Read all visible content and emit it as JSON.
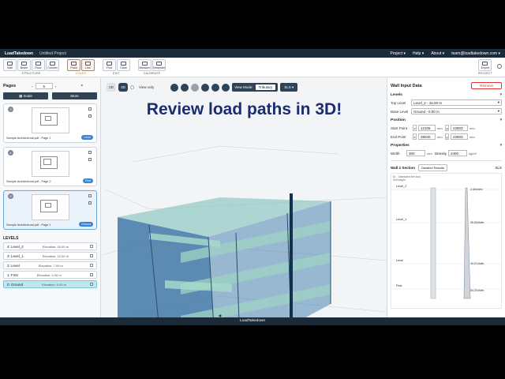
{
  "app": {
    "brand": "LoadTakedown",
    "project": "Untitled Project",
    "menus": [
      "Project",
      "Help",
      "About",
      "team@loadtakedown.com"
    ],
    "footer": "LoadTakedown"
  },
  "toolbar": {
    "groups": [
      {
        "label": "STRUCTURE",
        "buttons": [
          "Wall",
          "Beam",
          "Floor",
          "Column"
        ]
      },
      {
        "label": "LOADS",
        "buttons": [
          "Point",
          "Line"
        ]
      },
      {
        "label": "EDIT",
        "buttons": [
          "Find",
          "Clear"
        ]
      },
      {
        "label": "CALIBRATE",
        "buttons": [
          "Measure",
          "Viewpoint"
        ]
      }
    ],
    "export": {
      "button": "Export",
      "label": "PROJECT"
    }
  },
  "pages": {
    "title": "Pages",
    "current": "5",
    "scale_button": "Scale",
    "more_button": "More",
    "items": [
      {
        "num": "3",
        "title": "Sample Architectural.pdf - Page 1",
        "tag": "Level"
      },
      {
        "num": "4",
        "title": "Sample Architectural.pdf - Page 2",
        "tag": "First"
      },
      {
        "num": "5",
        "title": "Sample Architectural.pdf - Page 1",
        "tag": "Ground"
      }
    ]
  },
  "levels": {
    "title": "LEVELS",
    "items": [
      {
        "name": "4: Level_2",
        "elev": "Elevation: 16.00 m"
      },
      {
        "name": "3: Level_1",
        "elev": "Elevation: 12.00 m"
      },
      {
        "name": "2: Level",
        "elev": "Elevation: 7.00 m"
      },
      {
        "name": "1: First",
        "elev": "Elevation: 4.00 m"
      },
      {
        "name": "0: Ground",
        "elev": "Elevation: 0.00 m"
      }
    ]
  },
  "viewport": {
    "btn_2d": "2D",
    "btn_3d": "3D",
    "view_only": "View only",
    "view_mode_label": "View Mode:",
    "view_mode_value": "Tributary",
    "load_case": "SLS",
    "headline": "Review load paths in 3D!"
  },
  "panel": {
    "title": "Wall Input Data",
    "remove": "Remove",
    "levels_section": "Levels",
    "top_level_label": "Top Level",
    "top_level_value": "Level_2 - 16.00 m",
    "base_level_label": "Base Level",
    "base_level_value": "Ground - 0.00 m",
    "position_section": "Position",
    "start_label": "Start Point",
    "start_x": "12105",
    "start_y": "22803",
    "end_label": "End Point",
    "end_x": "39040",
    "end_y": "22803",
    "unit_mm": "mm",
    "properties_section": "Properties",
    "width_label": "Width",
    "width_value": "300",
    "density_label": "Density",
    "density_value": "2400",
    "density_unit": "kg/m³",
    "wall_section": "Wall 2 Section",
    "detailed_results": "Detailed Results",
    "section_case": "SLS",
    "legend_1": "DL",
    "legend_2": "Distributed line load",
    "legend_3": "Self weight",
    "chart_levels": [
      "Level_2",
      "Level_1",
      "Level",
      "First"
    ],
    "chart_values": [
      "2.45 kN/m",
      "28.26 kN/m",
      "43.07 kN/m",
      "54.23 kN/m"
    ]
  }
}
